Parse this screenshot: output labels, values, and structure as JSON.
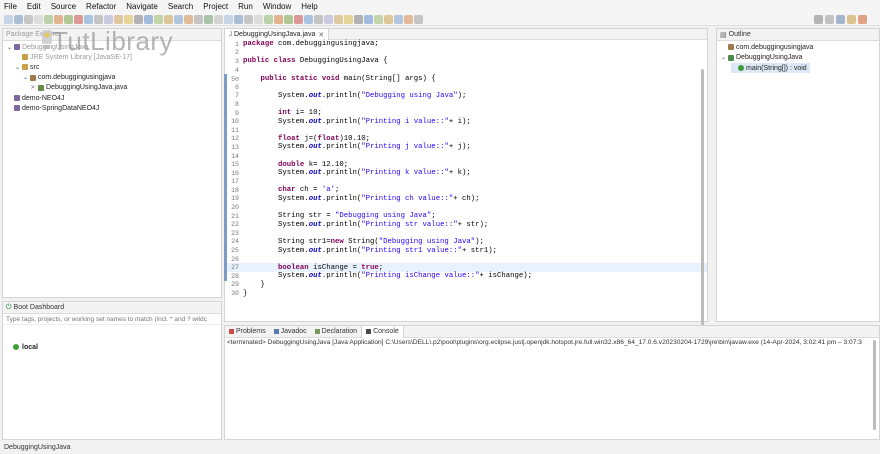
{
  "menu": [
    "File",
    "Edit",
    "Source",
    "Refactor",
    "Navigate",
    "Search",
    "Project",
    "Run",
    "Window",
    "Help"
  ],
  "package_explorer": {
    "tab": "Package Explorer",
    "items": [
      {
        "label": "DebuggingUsingJava",
        "indent": 0
      },
      {
        "label": "JRE System Library [JavaSE-17]",
        "indent": 1
      },
      {
        "label": "src",
        "indent": 1
      },
      {
        "label": "com.debuggingusingjava",
        "indent": 2
      },
      {
        "label": "DebuggingUsingJava.java",
        "indent": 3
      },
      {
        "label": "demo-NEO4J",
        "indent": 0
      },
      {
        "label": "demo-SpringDataNEO4J",
        "indent": 0
      }
    ]
  },
  "watermark": "TutLibrary",
  "editor": {
    "tab": "DebuggingUsingJava.java",
    "highlight_line": 27,
    "lines": [
      {
        "n": "1",
        "html": "<span class='kw'>package</span> com.debuggingusingjava;"
      },
      {
        "n": "2",
        "html": ""
      },
      {
        "n": "3",
        "html": "<span class='kw'>public class</span> DebuggingUsingJava {"
      },
      {
        "n": "4",
        "html": ""
      },
      {
        "n": "5⊖",
        "html": "    <span class='kw'>public static void</span> main(String[] args) {"
      },
      {
        "n": "6",
        "html": ""
      },
      {
        "n": "7",
        "html": "        System.<span class='fld'>out</span>.println(<span class='str'>\"Debugging using Java\"</span>);"
      },
      {
        "n": "8",
        "html": ""
      },
      {
        "n": "9",
        "html": "        <span class='kw'>int</span> i= 10;"
      },
      {
        "n": "10",
        "html": "        System.<span class='fld'>out</span>.println(<span class='str'>\"Printing i value::\"</span>+ i);"
      },
      {
        "n": "11",
        "html": ""
      },
      {
        "n": "12",
        "html": "        <span class='kw'>float</span> j=(<span class='kw'>float</span>)10.10;"
      },
      {
        "n": "13",
        "html": "        System.<span class='fld'>out</span>.println(<span class='str'>\"Printing j value::\"</span>+ j);"
      },
      {
        "n": "14",
        "html": ""
      },
      {
        "n": "15",
        "html": "        <span class='kw'>double</span> k= 12.10;"
      },
      {
        "n": "16",
        "html": "        System.<span class='fld'>out</span>.println(<span class='str'>\"Printing k value::\"</span>+ k);"
      },
      {
        "n": "17",
        "html": ""
      },
      {
        "n": "18",
        "html": "        <span class='kw'>char</span> ch = <span class='str'>'a'</span>;"
      },
      {
        "n": "19",
        "html": "        System.<span class='fld'>out</span>.println(<span class='str'>\"Printing ch value::\"</span>+ ch);"
      },
      {
        "n": "20",
        "html": ""
      },
      {
        "n": "21",
        "html": "        String str = <span class='str'>\"Debugging using Java\"</span>;"
      },
      {
        "n": "22",
        "html": "        System.<span class='fld'>out</span>.println(<span class='str'>\"Printing str value::\"</span>+ str);"
      },
      {
        "n": "23",
        "html": ""
      },
      {
        "n": "24",
        "html": "        String str1=<span class='kw'>new</span> String(<span class='str'>\"Debugging using Java\"</span>);"
      },
      {
        "n": "25",
        "html": "        System.<span class='fld'>out</span>.println(<span class='str'>\"Printing str1 value::\"</span>+ str1);"
      },
      {
        "n": "26",
        "html": ""
      },
      {
        "n": "27",
        "html": "        <span class='kw'>boolean</span> isChange = <span class='kw'>true</span>;"
      },
      {
        "n": "28",
        "html": "        System.<span class='fld'>out</span>.println(<span class='str'>\"Printing isChange value::\"</span>+ isChange);"
      },
      {
        "n": "29",
        "html": "    }"
      },
      {
        "n": "30",
        "html": "}"
      }
    ]
  },
  "outline": {
    "tab": "Outline",
    "items": [
      {
        "label": "com.debuggingusingjava",
        "indent": 0
      },
      {
        "label": "DebuggingUsingJava",
        "indent": 0
      },
      {
        "label": "main(String[]) : void",
        "indent": 1
      }
    ]
  },
  "boot_dashboard": {
    "tab": "Boot Dashboard",
    "filter_placeholder": "Type tags, projects, or working set names to match (incl. * and ? wildc",
    "item": "local"
  },
  "console": {
    "tabs": [
      "Problems",
      "Javadoc",
      "Declaration",
      "Console"
    ],
    "active": "Console",
    "terminated": "<terminated> DebuggingUsingJava [Java Application] C:\\Users\\DELL\\.p2\\pool\\plugins\\org.eclipse.justj.openjdk.hotspot.jre.full.win32.x86_64_17.0.6.v20230204-1729\\jre\\bin\\javaw.exe  (14-Apr-2024, 3:02:41 pm – 3:07:3"
  },
  "status": "DebuggingUsingJava",
  "colors": {
    "keyword": "#7f0055",
    "string": "#2a00ff",
    "field": "#0000c0"
  }
}
